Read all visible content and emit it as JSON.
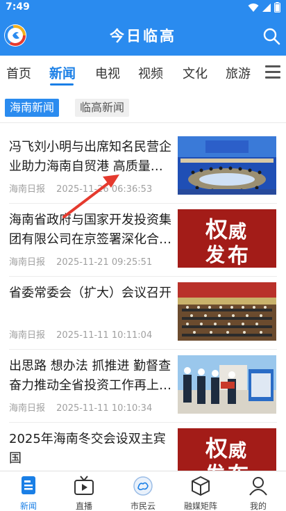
{
  "status_bar": {
    "time": "7:49"
  },
  "header": {
    "title": "今日临高"
  },
  "channels": [
    "首页",
    "新闻",
    "电视",
    "视频",
    "文化",
    "旅游"
  ],
  "active_channel": "新闻",
  "sub_tabs": [
    "海南新闻",
    "临高新闻"
  ],
  "news": [
    {
      "title": "冯飞刘小明与出席知名民营企业助力海南自贸港 高质量发展",
      "source": "海南日报",
      "time": "2025-11-26 06:36:53",
      "thumb": "meeting-hall"
    },
    {
      "title": "海南省政府与国家开发投资集团有限公司在京签署深化合作协议",
      "source": "海南日报",
      "time": "2025-11-21 09:25:51",
      "thumb": "badge",
      "badge": [
        "权",
        "威",
        "发",
        "布"
      ]
    },
    {
      "title": "省委常委会（扩大）会议召开",
      "source": "海南日报",
      "time": "2025-11-11 10:11:04",
      "thumb": "conference"
    },
    {
      "title": "出思路 想办法 抓推进 勤督查 奋力推动全省投资工作再上新台阶",
      "source": "海南日报",
      "time": "2025-11-11 10:10:34",
      "thumb": "site-visit"
    },
    {
      "title": "2025年海南冬交会设双主宾国",
      "source": "",
      "time": "",
      "thumb": "badge",
      "badge": [
        "权",
        "威",
        "发",
        "布"
      ]
    }
  ],
  "bottom_nav": [
    {
      "label": "新闻",
      "icon": "news-icon",
      "active": true
    },
    {
      "label": "直播",
      "icon": "live-tv-icon",
      "active": false
    },
    {
      "label": "市民云",
      "icon": "citizen-cloud-icon",
      "active": false
    },
    {
      "label": "融媒矩阵",
      "icon": "media-matrix-icon",
      "active": false
    },
    {
      "label": "我的",
      "icon": "profile-icon",
      "active": false
    }
  ],
  "colors": {
    "brand": "#2a8bef",
    "active": "#1a7fe6",
    "badge_red": "#a31c18",
    "annotation_arrow": "#e53a2e"
  }
}
